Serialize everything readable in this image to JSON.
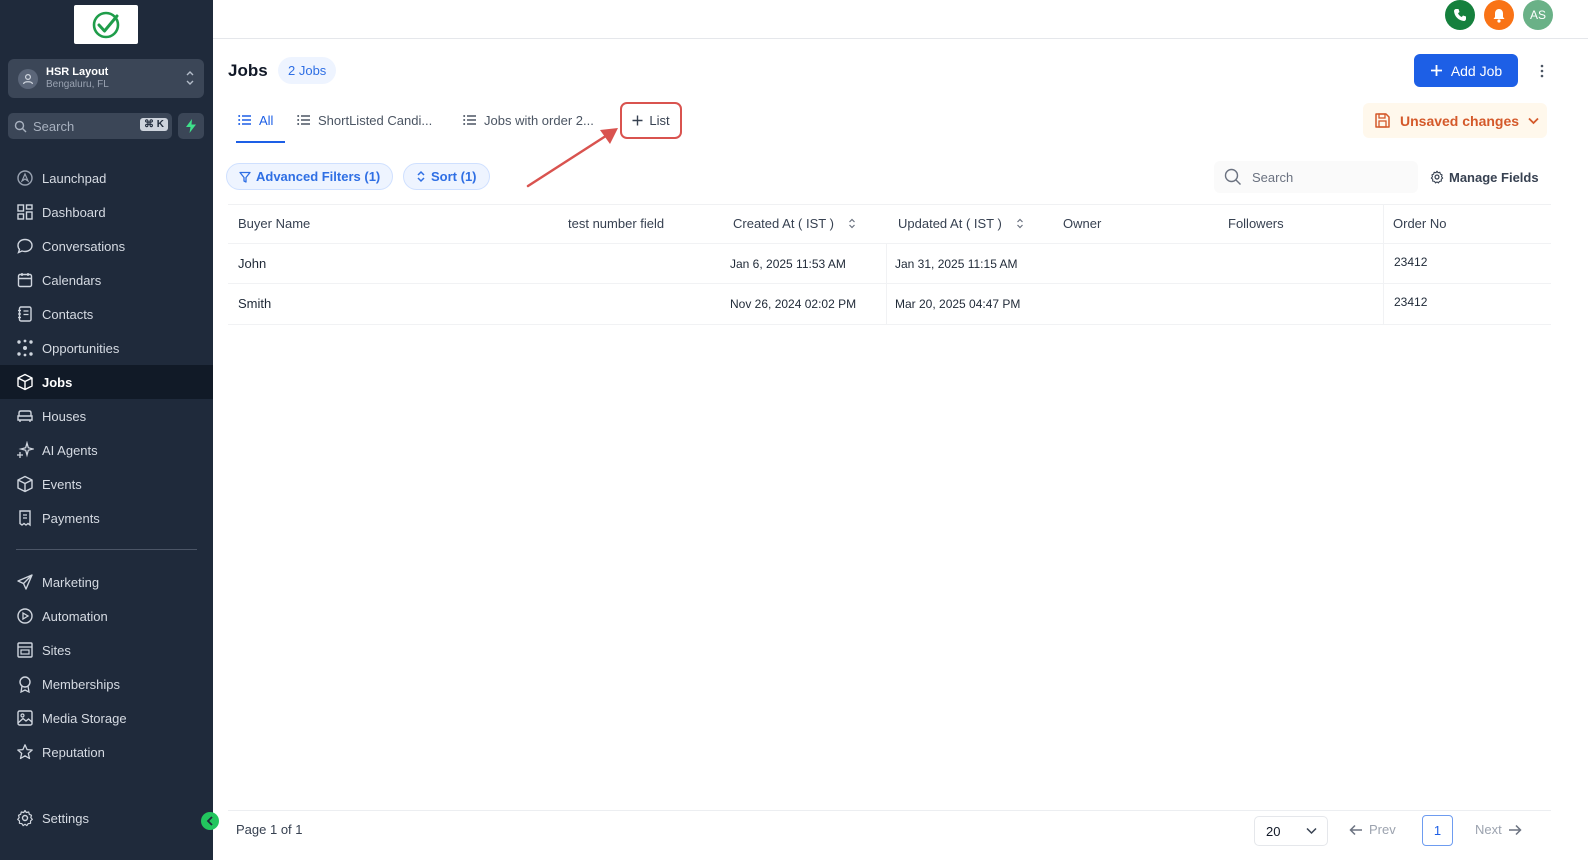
{
  "sidebar": {
    "location": {
      "name": "HSR Layout",
      "sub": "Bengaluru, FL"
    },
    "search": {
      "placeholder": "Search",
      "shortcut": "⌘ K"
    },
    "items": [
      {
        "label": "Launchpad",
        "icon": "rocket-icon"
      },
      {
        "label": "Dashboard",
        "icon": "grid-icon"
      },
      {
        "label": "Conversations",
        "icon": "chat-icon"
      },
      {
        "label": "Calendars",
        "icon": "calendar-icon"
      },
      {
        "label": "Contacts",
        "icon": "contacts-icon"
      },
      {
        "label": "Opportunities",
        "icon": "network-icon"
      },
      {
        "label": "Jobs",
        "icon": "cube-icon",
        "active": true
      },
      {
        "label": "Houses",
        "icon": "sofa-icon"
      },
      {
        "label": "AI Agents",
        "icon": "sparkle-icon"
      },
      {
        "label": "Events",
        "icon": "cube-icon"
      },
      {
        "label": "Payments",
        "icon": "receipt-icon"
      }
    ],
    "items2": [
      {
        "label": "Marketing",
        "icon": "send-icon"
      },
      {
        "label": "Automation",
        "icon": "automation-icon"
      },
      {
        "label": "Sites",
        "icon": "sites-icon"
      },
      {
        "label": "Memberships",
        "icon": "award-icon"
      },
      {
        "label": "Media Storage",
        "icon": "image-icon"
      },
      {
        "label": "Reputation",
        "icon": "star-icon"
      }
    ],
    "settings": "Settings"
  },
  "topbar": {
    "avatar": "AS"
  },
  "header": {
    "title": "Jobs",
    "count": "2 Jobs",
    "add_label": "Add Job"
  },
  "tabs": [
    {
      "label": "All"
    },
    {
      "label": "ShortListed Candi..."
    },
    {
      "label": "Jobs with order 2..."
    }
  ],
  "add_list_label": "List",
  "unsaved_label": "Unsaved changes",
  "filters": {
    "advanced": "Advanced Filters (1)",
    "sort": "Sort (1)"
  },
  "table_search_placeholder": "Search",
  "manage_fields": "Manage Fields",
  "table": {
    "columns": [
      "Buyer Name",
      "test number field",
      "Created At ( IST )",
      "Updated At ( IST )",
      "Owner",
      "Followers",
      "Order No"
    ],
    "rows": [
      {
        "buyer": "John",
        "created": "Jan 6, 2025 11:53 AM",
        "updated": "Jan 31, 2025 11:15 AM",
        "order": "23412"
      },
      {
        "buyer": "Smith",
        "created": "Nov 26, 2024 02:02 PM",
        "updated": "Mar 20, 2025 04:47 PM",
        "order": "23412"
      }
    ]
  },
  "footer": {
    "page_info": "Page 1 of 1",
    "per_page": "20",
    "prev": "Prev",
    "next": "Next",
    "current_page": "1"
  },
  "colors": {
    "sidebar_bg": "#1f2a3b",
    "primary": "#1d5fe6",
    "annotation_red": "#d9534f",
    "phone_green": "#15803d",
    "bell_orange": "#f97316",
    "avatar_green": "#6ab187"
  }
}
